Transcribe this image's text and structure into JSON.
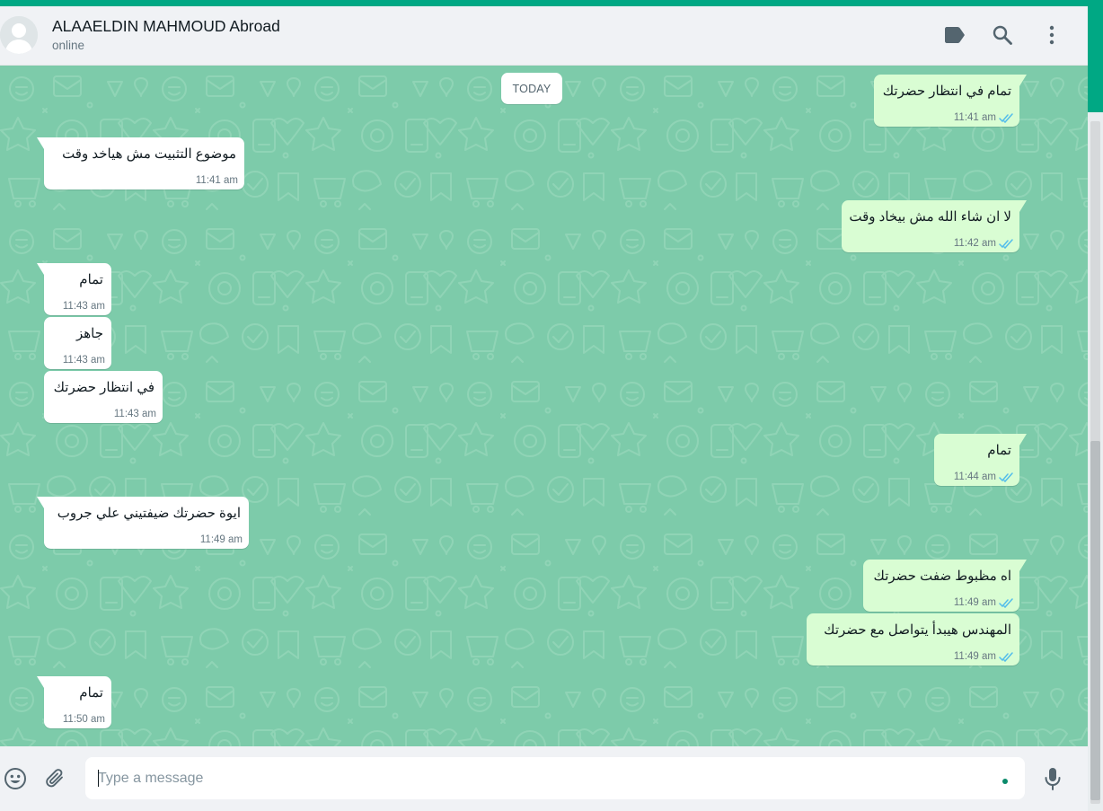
{
  "header": {
    "contact_name": "ALAAELDIN MAHMOUD Abroad",
    "status": "online",
    "icons": [
      "label-icon",
      "search-icon",
      "menu-icon"
    ]
  },
  "chat": {
    "date_divider": "TODAY",
    "messages": [
      {
        "dir": "out",
        "text": "تمام في انتظار حضرتك",
        "time": "11:41 am",
        "read": true
      },
      {
        "dir": "in",
        "text": "موضوع التثبيت مش هياخد وقت",
        "time": "11:41 am"
      },
      {
        "dir": "out",
        "text": "لا ان شاء الله مش بيخاد وقت",
        "time": "11:42 am",
        "read": true
      },
      {
        "dir": "in",
        "text": "تمام",
        "time": "11:43 am"
      },
      {
        "dir": "in",
        "text": "جاهز",
        "time": "11:43 am"
      },
      {
        "dir": "in",
        "text": "في انتظار حضرتك",
        "time": "11:43 am"
      },
      {
        "dir": "out",
        "text": "تمام",
        "time": "11:44 am",
        "read": true
      },
      {
        "dir": "in",
        "text": "ايوة حضرتك ضيفتيني علي جروب",
        "time": "11:49 am"
      },
      {
        "dir": "out",
        "text": "اه مظبوط ضفت حضرتك",
        "time": "11:49 am",
        "read": true
      },
      {
        "dir": "out",
        "text": "المهندس هيبدأ يتواصل مع حضرتك",
        "time": "11:49 am",
        "read": true
      },
      {
        "dir": "in",
        "text": "تمام",
        "time": "11:50 am"
      }
    ]
  },
  "composer": {
    "placeholder": "Type a message",
    "value": "",
    "icons": [
      "emoji-icon",
      "attach-icon",
      "microphone-icon"
    ]
  },
  "colors": {
    "accent": "#00a884",
    "wallpaper": "#7dcbaa",
    "outgoing_bubble": "#d9fdd3",
    "incoming_bubble": "#ffffff",
    "read_ticks": "#53bdeb"
  }
}
